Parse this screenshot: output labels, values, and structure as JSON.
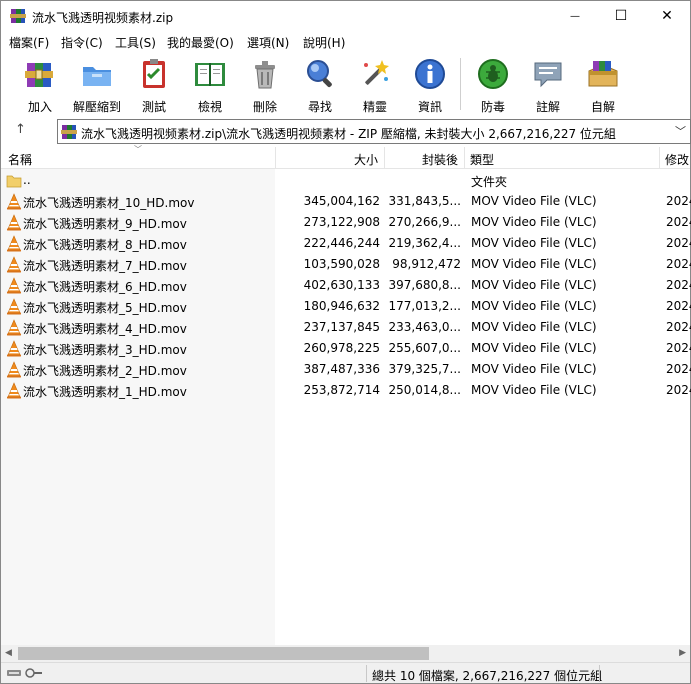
{
  "window": {
    "title": "流水飞溅透明视频素材.zip",
    "minimize": "—",
    "maximize": "☐",
    "close": "✕"
  },
  "menu": [
    {
      "label": "檔案(F)"
    },
    {
      "label": "指令(C)"
    },
    {
      "label": "工具(S)"
    },
    {
      "label": "我的最愛(O)"
    },
    {
      "label": "選項(N)"
    },
    {
      "label": "說明(H)"
    }
  ],
  "toolbar": [
    {
      "label": "加入",
      "icon": "add-archive-icon"
    },
    {
      "label": "解壓縮到",
      "icon": "extract-to-icon"
    },
    {
      "label": "測試",
      "icon": "test-icon"
    },
    {
      "label": "檢視",
      "icon": "view-icon"
    },
    {
      "label": "刪除",
      "icon": "delete-icon"
    },
    {
      "label": "尋找",
      "icon": "find-icon"
    },
    {
      "label": "精靈",
      "icon": "wizard-icon"
    },
    {
      "label": "資訊",
      "icon": "info-icon"
    },
    {
      "label": "防毒",
      "icon": "virus-scan-icon"
    },
    {
      "label": "註解",
      "icon": "comment-icon"
    },
    {
      "label": "自解",
      "icon": "sfx-icon"
    }
  ],
  "address": {
    "up": "↑",
    "text": "流水飞溅透明视频素材.zip\\流水飞溅透明视频素材 - ZIP 壓縮檔, 未封裝大小 2,667,216,227 位元組",
    "dropdown": "﹀"
  },
  "columns": {
    "name": "名稱",
    "size": "大小",
    "packed": "封裝後",
    "type": "類型",
    "modified": "修改"
  },
  "parent_row": {
    "name": "..",
    "type": "文件夾"
  },
  "files": [
    {
      "name": "流水飞溅透明素材_10_HD.mov",
      "size": "345,004,162",
      "packed": "331,843,5...",
      "type": "MOV Video File (VLC)",
      "modified": "2024"
    },
    {
      "name": "流水飞溅透明素材_9_HD.mov",
      "size": "273,122,908",
      "packed": "270,266,9...",
      "type": "MOV Video File (VLC)",
      "modified": "2024"
    },
    {
      "name": "流水飞溅透明素材_8_HD.mov",
      "size": "222,446,244",
      "packed": "219,362,4...",
      "type": "MOV Video File (VLC)",
      "modified": "2024"
    },
    {
      "name": "流水飞溅透明素材_7_HD.mov",
      "size": "103,590,028",
      "packed": "98,912,472",
      "type": "MOV Video File (VLC)",
      "modified": "2024"
    },
    {
      "name": "流水飞溅透明素材_6_HD.mov",
      "size": "402,630,133",
      "packed": "397,680,8...",
      "type": "MOV Video File (VLC)",
      "modified": "2024"
    },
    {
      "name": "流水飞溅透明素材_5_HD.mov",
      "size": "180,946,632",
      "packed": "177,013,2...",
      "type": "MOV Video File (VLC)",
      "modified": "2024"
    },
    {
      "name": "流水飞溅透明素材_4_HD.mov",
      "size": "237,137,845",
      "packed": "233,463,0...",
      "type": "MOV Video File (VLC)",
      "modified": "2024"
    },
    {
      "name": "流水飞溅透明素材_3_HD.mov",
      "size": "260,978,225",
      "packed": "255,607,0...",
      "type": "MOV Video File (VLC)",
      "modified": "2024"
    },
    {
      "name": "流水飞溅透明素材_2_HD.mov",
      "size": "387,487,336",
      "packed": "379,325,7...",
      "type": "MOV Video File (VLC)",
      "modified": "2024"
    },
    {
      "name": "流水飞溅透明素材_1_HD.mov",
      "size": "253,872,714",
      "packed": "250,014,8...",
      "type": "MOV Video File (VLC)",
      "modified": "2024"
    }
  ],
  "status": {
    "text": "總共 10 個檔案, 2,667,216,227 個位元組"
  },
  "scrollbar": {
    "left": "◀",
    "right": "▶"
  }
}
